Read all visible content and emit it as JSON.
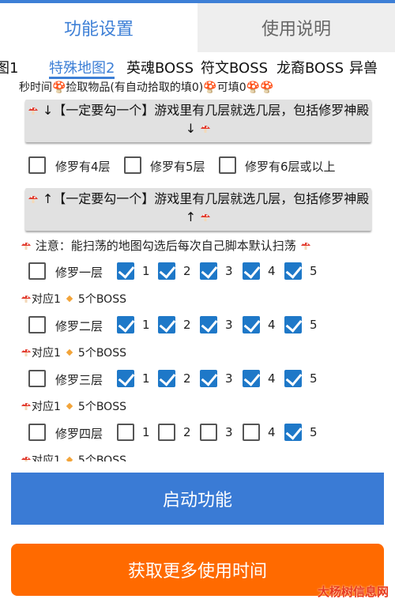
{
  "main_tabs": [
    "功能设置",
    "使用说明"
  ],
  "sub_tabs": [
    "图1",
    "特殊地图2",
    "英魂BOSS",
    "符文BOSS",
    "龙裔BOSS",
    "异兽"
  ],
  "pickup_note": "秒时间🍄捡取物品(有自动拾取的填0)🍄可填0🍄🍄",
  "layer_button_top": "↓【一定要勾一个】游戏里有几层就选几层，包括修罗神殿↓",
  "layer_options": [
    "修罗有4层",
    "修罗有5层",
    "修罗有6层或以上"
  ],
  "layer_button_bottom": "↑【一定要勾一个】游戏里有几层就选几层，包括修罗神殿↑",
  "scan_note": "注意：能扫荡的地图勾选后每次自己脚本默认扫荡",
  "floors": [
    {
      "name": "修罗一层",
      "checked": false,
      "bosses": [
        {
          "label": "1",
          "checked": true
        },
        {
          "label": "2",
          "checked": true
        },
        {
          "label": "3",
          "checked": true
        },
        {
          "label": "4",
          "checked": true
        },
        {
          "label": "5",
          "checked": true
        }
      ]
    },
    {
      "name": "修罗二层",
      "checked": false,
      "bosses": [
        {
          "label": "1",
          "checked": true
        },
        {
          "label": "2",
          "checked": true
        },
        {
          "label": "3",
          "checked": true
        },
        {
          "label": "4",
          "checked": true
        },
        {
          "label": "5",
          "checked": true
        }
      ]
    },
    {
      "name": "修罗三层",
      "checked": false,
      "bosses": [
        {
          "label": "1",
          "checked": true
        },
        {
          "label": "2",
          "checked": true
        },
        {
          "label": "3",
          "checked": true
        },
        {
          "label": "4",
          "checked": true
        },
        {
          "label": "5",
          "checked": true
        }
      ]
    },
    {
      "name": "修罗四层",
      "checked": false,
      "bosses": [
        {
          "label": "1",
          "checked": false
        },
        {
          "label": "2",
          "checked": false
        },
        {
          "label": "3",
          "checked": false
        },
        {
          "label": "4",
          "checked": false
        },
        {
          "label": "5",
          "checked": true
        }
      ]
    }
  ],
  "mapping_note": {
    "prefix": "对应1",
    "suffix": "5个BOSS"
  },
  "start_button": "启动功能",
  "more_time_button": "获取更多使用时间",
  "watermark": "大杨树信息网",
  "colors": {
    "accent": "#3d7fd6",
    "checkbox": "#1e78c8",
    "start": "#3a7bd5",
    "more": "#ff6a00",
    "mushroom": "#e23b2e"
  }
}
